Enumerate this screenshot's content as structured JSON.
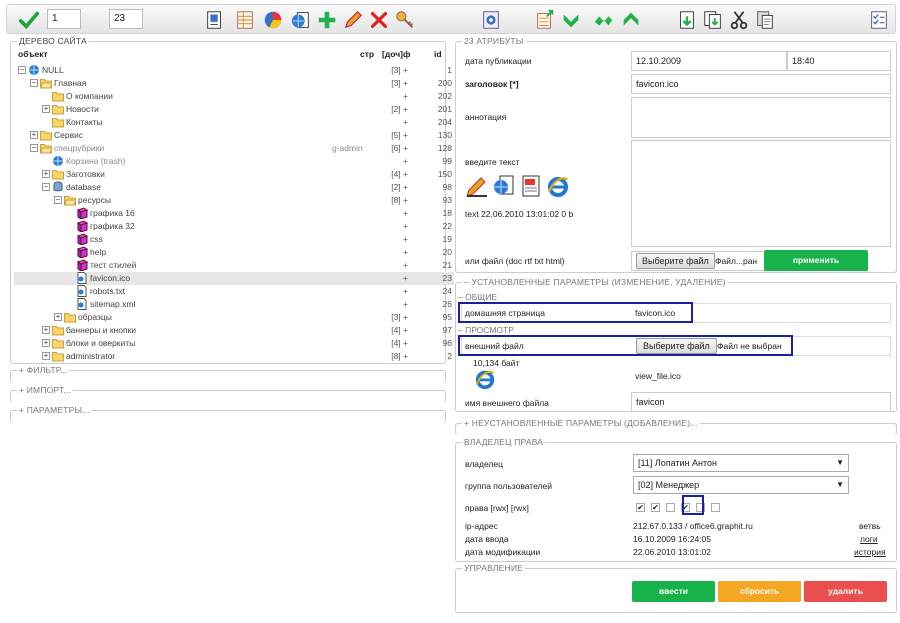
{
  "toolbar": {
    "input1_value": "1",
    "input2_value": "23",
    "icons_left": [
      "check-icon"
    ],
    "icons_center": [
      "copy-page-icon",
      "grid-icon",
      "chart-icon",
      "globe-page-icon",
      "add-icon",
      "edit-icon",
      "delete-icon",
      "keys-icon"
    ],
    "icons_right": [
      "settings-icon",
      "export-icon",
      "sort-down-icon",
      "sort-swap-icon",
      "sort-up-icon",
      "import-icon",
      "import-multi-icon",
      "cut-icon",
      "paste-icon",
      "checklist-icon"
    ]
  },
  "tree": {
    "legend": "ДЕРЕВО САЙТА",
    "col_object": "объект",
    "col_str": "стр",
    "col_doc": "[доч]ф",
    "col_id": "id",
    "rows": [
      {
        "name": "NULL",
        "str": "[3] +",
        "id": "1"
      },
      {
        "name": "Главная",
        "str": "[3] +",
        "id": "200"
      },
      {
        "name": "О компании",
        "str": "+",
        "id": "202"
      },
      {
        "name": "Новости",
        "str": "[2] +",
        "id": "201"
      },
      {
        "name": "Контакты",
        "str": "+",
        "id": "204"
      },
      {
        "name": "Сервис",
        "str": "[5] +",
        "id": "130"
      },
      {
        "name": "спецрубрики",
        "user": "g-admin",
        "str": "[6] +",
        "id": "128"
      },
      {
        "name": "Корзина (trash)",
        "str": "+",
        "id": "99"
      },
      {
        "name": "Заготовки",
        "str": "[4] +",
        "id": "150"
      },
      {
        "name": "database",
        "str": "[2] +",
        "id": "98"
      },
      {
        "name": "ресурсы",
        "str": "[8] +",
        "id": "93"
      },
      {
        "name": "графика 16",
        "str": "+",
        "id": "18"
      },
      {
        "name": "графика 32",
        "str": "+",
        "id": "22"
      },
      {
        "name": "css",
        "str": "+",
        "id": "19"
      },
      {
        "name": "help",
        "str": "+",
        "id": "20"
      },
      {
        "name": "тест стилей",
        "str": "+",
        "id": "21"
      },
      {
        "name": "favicon.ico",
        "str": "+",
        "id": "23"
      },
      {
        "name": "robots.txt",
        "str": "+",
        "id": "24"
      },
      {
        "name": "sitemap.xml",
        "str": "+",
        "id": "26"
      },
      {
        "name": "образцы",
        "str": "[3] +",
        "id": "95"
      },
      {
        "name": "баннеры и кнопки",
        "str": "[4] +",
        "id": "97"
      },
      {
        "name": "блоки и оверкиты",
        "str": "[4] +",
        "id": "96"
      },
      {
        "name": "administrator",
        "str": "[8] +",
        "id": "2"
      }
    ]
  },
  "left_sections": [
    "+ ФИЛЬТР...",
    "+ ИМПОРТ...",
    "+ ПАРАМЕТРЫ..."
  ],
  "attributes": {
    "legend": "23 АТРИБУТЫ",
    "pub_date_label": "дата публикации",
    "pub_date": "12.10.2009",
    "pub_time": "18:40",
    "title_label": "заголовок",
    "title_marker": "[*]",
    "title_value": "favicon.ico",
    "annotation_label": "аннотация",
    "text_label": "введите текст",
    "text_info": "text 22.06.2010 13:01:02 0 b",
    "file_label": "или файл (doc rtf txt html)",
    "choose_file": "Выберите файл",
    "file_status_short": "Файл...ран",
    "apply_button": "применить"
  },
  "installed": {
    "legend": "– УСТАНОВЛЕННЫЕ ПАРАМЕТРЫ (ИЗМЕНЕНИЕ, УДАЛЕНИЕ)",
    "general_legend": "– ОБЩИЕ",
    "homepage_label": "домашняя страница",
    "homepage_value": "favicon.ico",
    "view_legend": "– ПРОСМОТР",
    "ext_file_label": "внешний файл",
    "choose_file": "Выберите файл",
    "file_status": "Файл не выбран",
    "file_size": "10,134 байт",
    "view_file": "view_file.ico",
    "ext_name_label": "имя внешнего файла",
    "ext_name_value": "favicon"
  },
  "uninstalled_legend": "+ НЕУСТАНОВЛЕННЫЕ ПАРАМЕТРЫ (ДОБАВЛЕНИЕ)...",
  "owner": {
    "legend": "ВЛАДЕЛЕЦ ПРАВА",
    "owner_label": "владелец",
    "owner_value": "[11] Лопатин Антон",
    "group_label": "группа пользователей",
    "group_value": "[02] Менеджер",
    "rights_label": "права [rwx] [rwx]",
    "rights": [
      true,
      true,
      false,
      true,
      false,
      false
    ],
    "ip_label": "ip-адрес",
    "ip_value": "212.67.0.133 / office6.graphit.ru",
    "branch_link": "ветвь",
    "date_in_label": "дата ввода",
    "date_in_value": "16.10.2009 16:24:05",
    "logs_link": "логи",
    "date_mod_label": "дата модификации",
    "date_mod_value": "22.06.2010 13:01:02",
    "history_link": "история"
  },
  "control": {
    "legend": "УПРАВЛЕНИЕ",
    "enter_button": "ввести",
    "reset_button": "сбросить",
    "delete_button": "удалить"
  },
  "colors": {
    "green": "#17b34a",
    "orange": "#f5a623",
    "red": "#ea4f4f",
    "highlight": "#1b1fa8"
  }
}
